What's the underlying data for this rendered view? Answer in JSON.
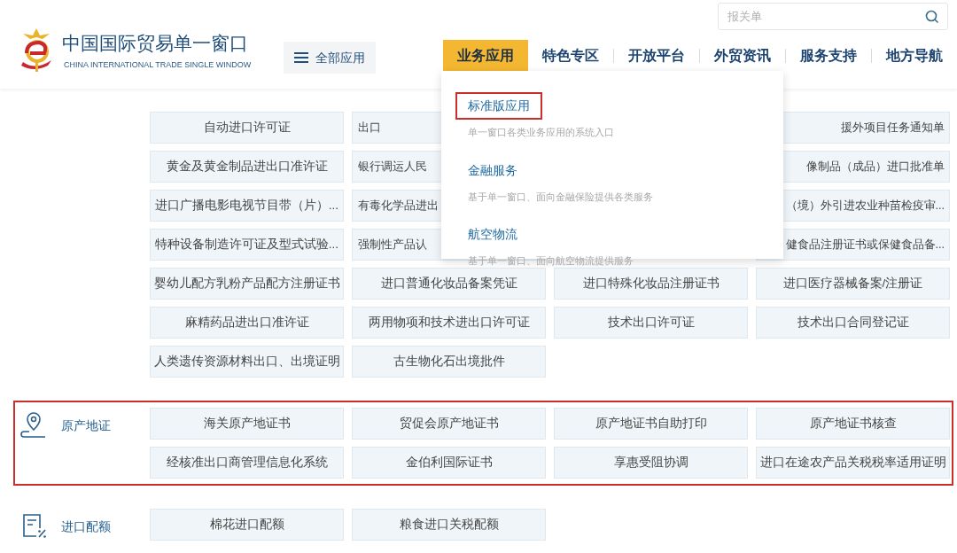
{
  "header": {
    "title": "中国国际贸易单一窗口",
    "subtitle": "CHINA INTERNATIONAL TRADE SINGLE WINDOW",
    "all_apps_button": "全部应用",
    "search": {
      "placeholder": "报关单"
    },
    "nav": [
      {
        "label": "业务应用",
        "selected": true
      },
      {
        "label": "特色专区",
        "selected": false
      },
      {
        "label": "开放平台",
        "selected": false
      },
      {
        "label": "外贸资讯",
        "selected": false
      },
      {
        "label": "服务支持",
        "selected": false
      },
      {
        "label": "地方导航",
        "selected": false
      }
    ]
  },
  "dropdown": {
    "items": [
      {
        "title": "标准版应用",
        "description": "单一窗口各类业务应用的系统入口",
        "selected": true
      },
      {
        "title": "金融服务",
        "description": "基于单一窗口、面向金融保险提供各类服务",
        "selected": false
      },
      {
        "title": "航空物流",
        "description": "基于单一窗口、面向航空物流提供服务",
        "selected": false
      }
    ]
  },
  "license_rows": [
    [
      "自动进口许可证",
      "出口",
      null,
      "援外项目任务通知单"
    ],
    [
      "黄金及黄金制品进出口准许证",
      "银行调运人民",
      null,
      "像制品（成品）进口批准单"
    ],
    [
      "进口广播电影电视节目带（片）...",
      "有毒化学品进出",
      null,
      "（境）外引进农业种苗检疫审..."
    ],
    [
      "特种设备制造许可证及型式试验...",
      "强制性产品认",
      null,
      "健食品注册证书或保健食品备..."
    ],
    [
      "婴幼儿配方乳粉产品配方注册证书",
      "进口普通化妆品备案凭证",
      "进口特殊化妆品注册证书",
      "进口医疗器械备案/注册证"
    ],
    [
      "麻精药品进出口准许证",
      "两用物项和技术进出口许可证",
      "技术出口许可证",
      "技术出口合同登记证"
    ],
    [
      "人类遗传资源材料出口、出境证明",
      "古生物化石出境批件"
    ]
  ],
  "sections": [
    {
      "kind": "origin",
      "label": "原产地证",
      "highlighted": true,
      "items": [
        "海关原产地证书",
        "贸促会原产地证书",
        "原产地证书自助打印",
        "原产地证书核查",
        "经核准出口商管理信息化系统",
        "金伯利国际证书",
        "享惠受阻协调",
        "进口在途农产品关税税率适用证明"
      ]
    },
    {
      "kind": "quota",
      "label": "进口配额",
      "highlighted": false,
      "items": [
        "棉花进口配额",
        "粮食进口关税配额"
      ]
    }
  ]
}
